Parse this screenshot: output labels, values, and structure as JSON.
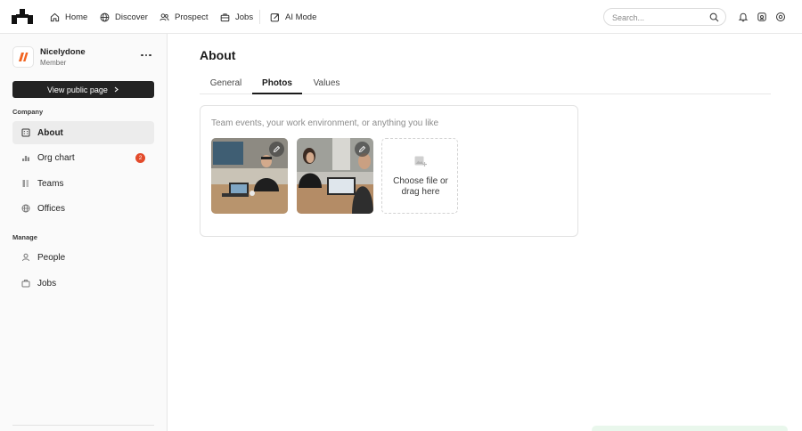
{
  "nav": {
    "items": [
      {
        "label": "Home",
        "icon": "home-icon"
      },
      {
        "label": "Discover",
        "icon": "globe-icon"
      },
      {
        "label": "Prospect",
        "icon": "people-icon"
      },
      {
        "label": "Jobs",
        "icon": "briefcase-icon"
      },
      {
        "label": "AI Mode",
        "icon": "ai-mode-icon"
      }
    ],
    "search_placeholder": "Search..."
  },
  "org": {
    "name": "Nicelydone",
    "role": "Member",
    "logo_color": "#f26522"
  },
  "sidebar": {
    "view_public_label": "View public page",
    "company_label": "Company",
    "company_items": [
      {
        "label": "About",
        "icon": "building-icon",
        "active": true
      },
      {
        "label": "Org chart",
        "icon": "org-chart-icon",
        "badge": "2"
      },
      {
        "label": "Teams",
        "icon": "teams-icon"
      },
      {
        "label": "Offices",
        "icon": "globe-icon"
      }
    ],
    "manage_label": "Manage",
    "manage_items": [
      {
        "label": "People",
        "icon": "person-icon"
      },
      {
        "label": "Jobs",
        "icon": "briefcase-icon"
      }
    ]
  },
  "main": {
    "title": "About",
    "tabs": [
      {
        "label": "General"
      },
      {
        "label": "Photos",
        "active": true
      },
      {
        "label": "Values"
      }
    ],
    "photos": {
      "hint": "Team events, your work environment, or anything you like",
      "upload_label": "Choose file or drag here"
    }
  },
  "colors": {
    "accent_dark": "#232323",
    "badge": "#e34b2b",
    "active_bg": "#ececec"
  }
}
